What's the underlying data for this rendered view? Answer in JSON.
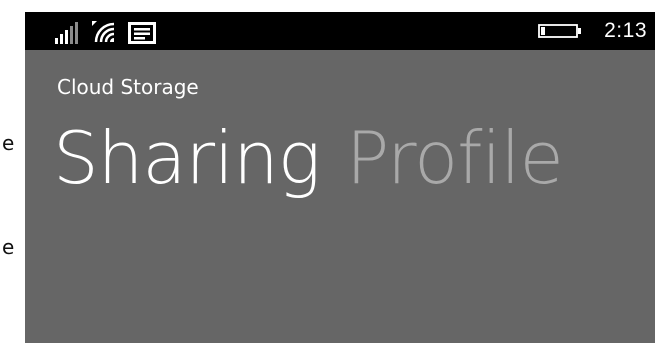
{
  "edge_fragments": [
    "e",
    "e"
  ],
  "status_bar": {
    "signal_icon": "signal-strength-icon",
    "wifi_icon": "wifi-icon",
    "message_icon": "message-icon",
    "battery_icon": "battery-icon",
    "time": "2:13"
  },
  "app": {
    "title": "Cloud Storage"
  },
  "pivot": {
    "items": [
      {
        "label": "Sharing",
        "active": true
      },
      {
        "label": "Profile",
        "active": false
      }
    ]
  },
  "colors": {
    "status_bar_bg": "#000000",
    "page_bg": "#666666",
    "active_header": "#ffffff",
    "inactive_header": "#a9a9a9"
  }
}
